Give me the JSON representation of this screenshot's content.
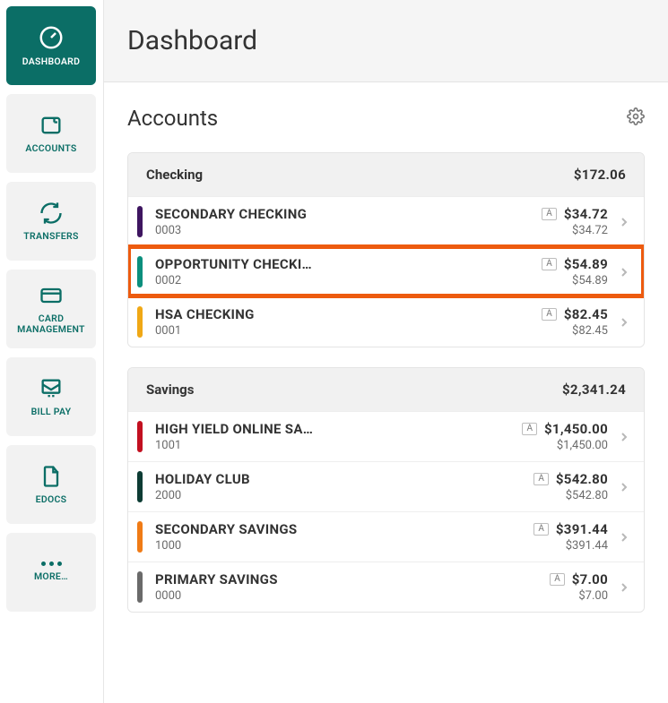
{
  "sidebar": {
    "items": [
      {
        "label": "DASHBOARD"
      },
      {
        "label": "ACCOUNTS"
      },
      {
        "label": "TRANSFERS"
      },
      {
        "label": "CARD MANAGEMENT"
      },
      {
        "label": "BILL PAY"
      },
      {
        "label": "EDOCS"
      },
      {
        "label": "MORE…"
      }
    ]
  },
  "header": {
    "title": "Dashboard"
  },
  "accounts_section": {
    "title": "Accounts",
    "groups": [
      {
        "title": "Checking",
        "total": "$172.06",
        "accounts": [
          {
            "name": "SECONDARY CHECKING",
            "num": "0003",
            "badge": "A",
            "balance": "$34.72",
            "avail": "$34.72",
            "color": "#3e1560",
            "highlight": false
          },
          {
            "name": "OPPORTUNITY CHECKI…",
            "num": "0002",
            "badge": "A",
            "balance": "$54.89",
            "avail": "$54.89",
            "color": "#0b8f7d",
            "highlight": true
          },
          {
            "name": "HSA CHECKING",
            "num": "0001",
            "badge": "A",
            "balance": "$82.45",
            "avail": "$82.45",
            "color": "#f0a816",
            "highlight": false
          }
        ]
      },
      {
        "title": "Savings",
        "total": "$2,341.24",
        "accounts": [
          {
            "name": "HIGH YIELD ONLINE SA…",
            "num": "1001",
            "badge": "A",
            "balance": "$1,450.00",
            "avail": "$1,450.00",
            "color": "#c21020",
            "highlight": false
          },
          {
            "name": "HOLIDAY CLUB",
            "num": "2000",
            "badge": "A",
            "balance": "$542.80",
            "avail": "$542.80",
            "color": "#0d3c34",
            "highlight": false
          },
          {
            "name": "SECONDARY SAVINGS",
            "num": "1000",
            "badge": "A",
            "balance": "$391.44",
            "avail": "$391.44",
            "color": "#f07b16",
            "highlight": false
          },
          {
            "name": "PRIMARY SAVINGS",
            "num": "0000",
            "badge": "A",
            "balance": "$7.00",
            "avail": "$7.00",
            "color": "#6a6a6a",
            "highlight": false
          }
        ]
      }
    ]
  }
}
